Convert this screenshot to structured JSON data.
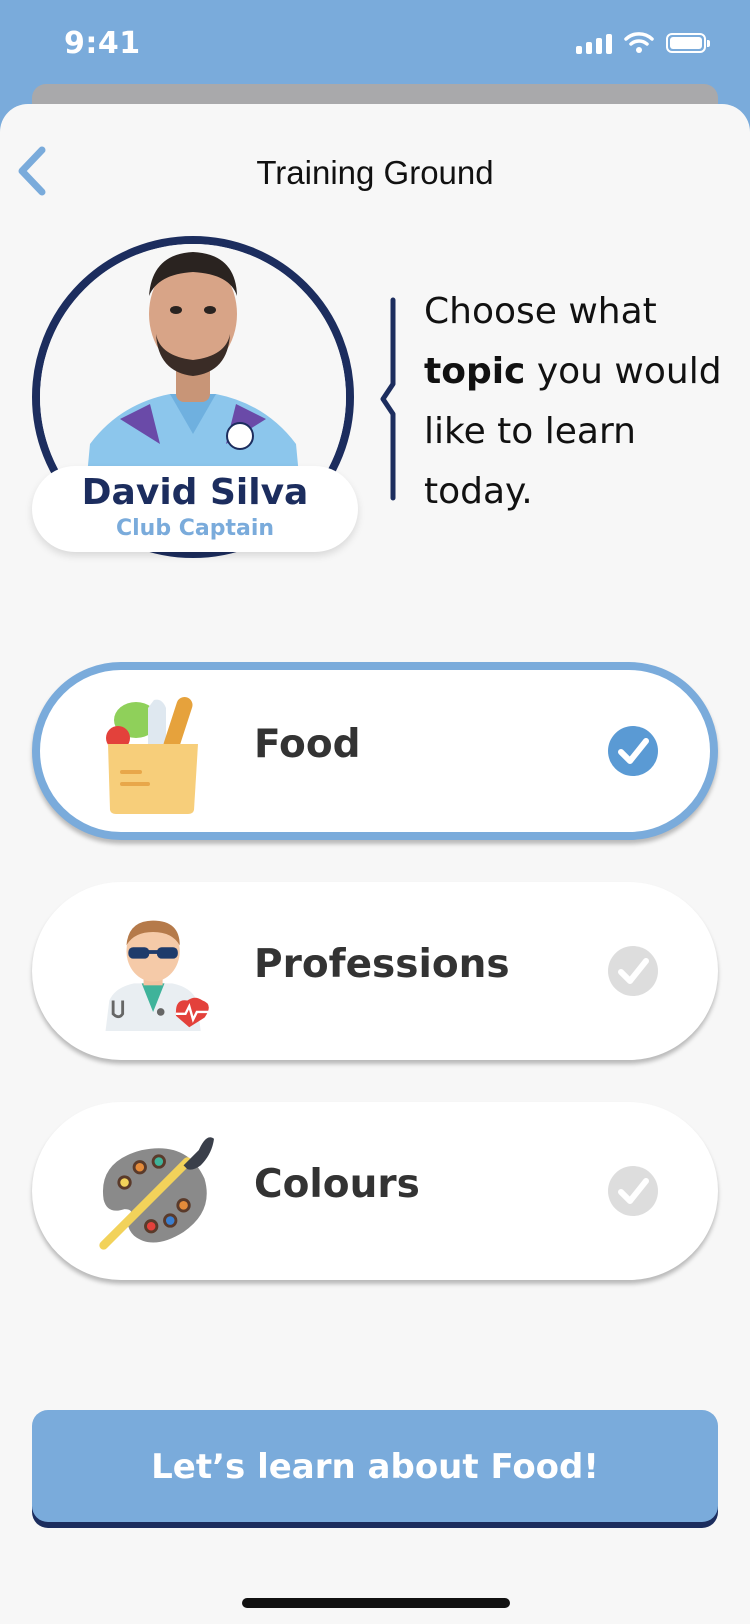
{
  "status_bar": {
    "time": "9:41"
  },
  "nav": {
    "title": "Training Ground"
  },
  "coach": {
    "name": "David Silva",
    "role": "Club Captain"
  },
  "prompt": {
    "before": "Choose what ",
    "bold": "topic",
    "after": " you would like to learn today."
  },
  "topics": [
    {
      "label": "Food",
      "icon": "grocery-bag-icon",
      "selected": true
    },
    {
      "label": "Professions",
      "icon": "doctor-icon",
      "selected": false
    },
    {
      "label": "Colours",
      "icon": "palette-icon",
      "selected": false
    }
  ],
  "cta": {
    "label": "Let’s learn about Food!"
  },
  "colors": {
    "accent": "#7aabdb",
    "navy": "#1c2d5e",
    "check_on": "#5a9ad4",
    "check_off": "#dddddd",
    "sheet": "#f7f7f7"
  }
}
